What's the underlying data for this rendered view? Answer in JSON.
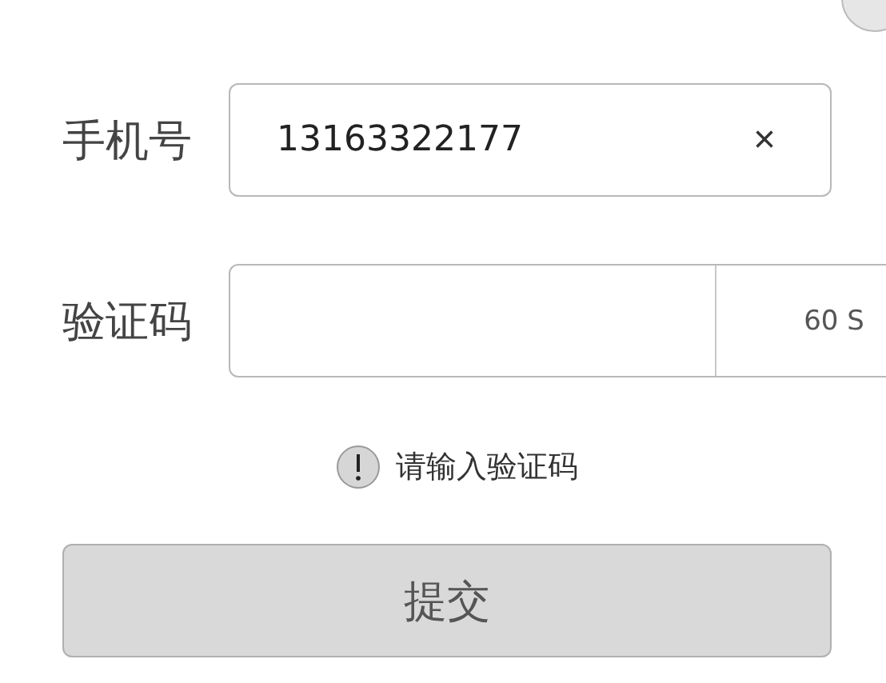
{
  "phone": {
    "label": "手机号",
    "value": "13163322177",
    "clear": "×"
  },
  "code": {
    "label": "验证码",
    "countdown": "60 S"
  },
  "warning": {
    "text": "请输入验证码"
  },
  "submit": {
    "label": "提交",
    "disabled": true
  }
}
